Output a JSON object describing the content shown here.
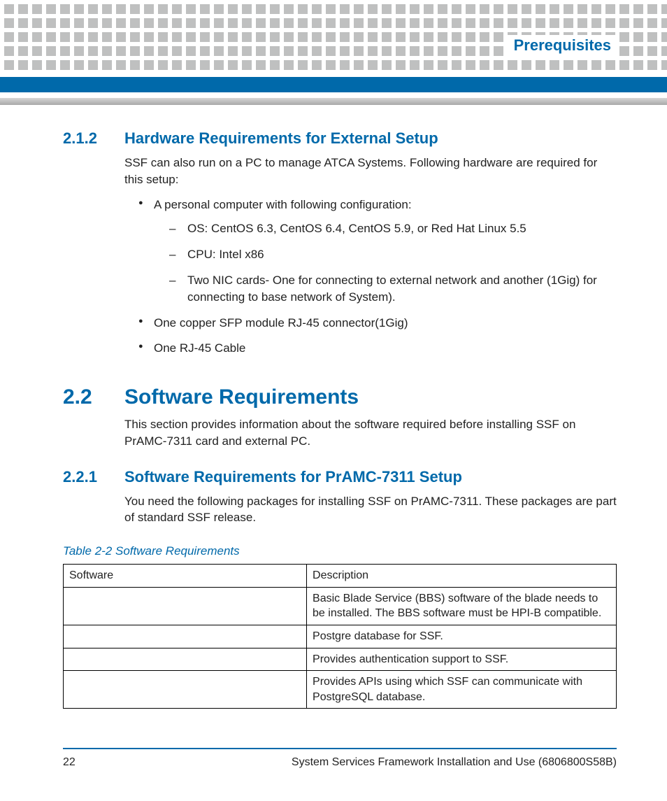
{
  "header": {
    "chapter": "Prerequisites"
  },
  "s212": {
    "num": "2.1.2",
    "title": "Hardware Requirements for External Setup",
    "intro": "SSF can also run on a PC to manage ATCA Systems. Following hardware are required for this setup:",
    "b1": "A personal computer with following configuration:",
    "d1": "OS: CentOS 6.3, CentOS 6.4, CentOS 5.9, or Red Hat Linux 5.5",
    "d2": "CPU: Intel x86",
    "d3": "Two NIC cards- One for connecting to external network and another (1Gig) for connecting to base network of System).",
    "b2": "One copper SFP module RJ-45 connector(1Gig)",
    "b3": "One RJ-45 Cable"
  },
  "s22": {
    "num": "2.2",
    "title": "Software Requirements",
    "intro": "This section provides information about the software required before installing SSF on PrAMC-7311 card and external PC."
  },
  "s221": {
    "num": "2.2.1",
    "title": "Software Requirements for PrAMC-7311 Setup",
    "intro": "You need the following packages for installing SSF on PrAMC-7311. These packages are part of standard SSF release."
  },
  "table": {
    "caption": "Table 2-2 Software Requirements",
    "h1": "Software",
    "h2": "Description",
    "r1s": "",
    "r1d": "Basic Blade Service (BBS) software of the blade needs to be installed. The BBS software must be HPI-B compatible.",
    "r2s": "",
    "r2d": "Postgre database for SSF.",
    "r3s": "",
    "r3d": "Provides authentication support to SSF.",
    "r4s": "",
    "r4d": "Provides APIs using which SSF can communicate with PostgreSQL database."
  },
  "footer": {
    "page": "22",
    "doc": "System Services Framework Installation and Use (6806800S58B)"
  }
}
